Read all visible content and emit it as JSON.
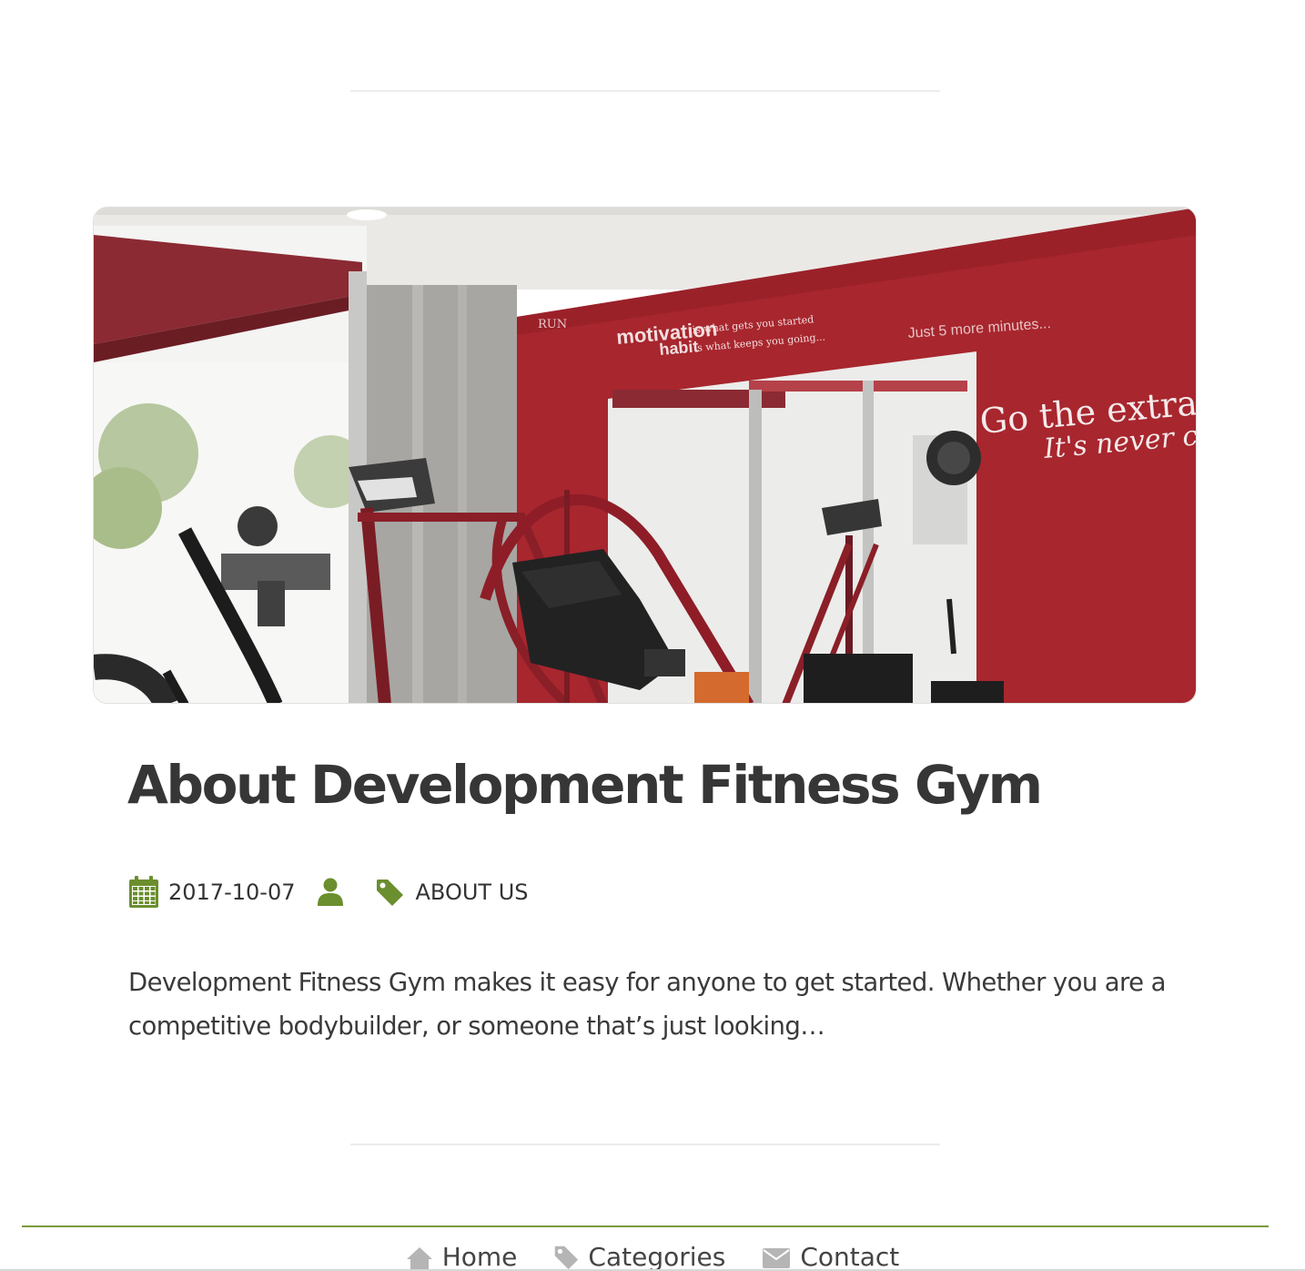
{
  "post": {
    "title": "About Development Fitness Gym",
    "date": "2017-10-07",
    "category": "ABOUT US",
    "excerpt": "Development Fitness Gym makes it easy for anyone to get started. Whether you are a competitive bodybuilder, or someone that’s just looking…",
    "image": {
      "wall_text_1a": "motivation",
      "wall_text_1b": "is what gets you started",
      "wall_text_2a": "habit",
      "wall_text_2b": "is what keeps you going...",
      "wall_text_run": "RUN",
      "wall_text_3": "Just 5 more minutes...",
      "wall_text_4": "Go the extra m",
      "wall_text_5": "It's never crow"
    }
  },
  "footer": {
    "nav": [
      {
        "label": "Home",
        "icon": "home-icon"
      },
      {
        "label": "Categories",
        "icon": "tag-icon"
      },
      {
        "label": "Contact",
        "icon": "envelope-icon"
      }
    ]
  },
  "colors": {
    "accent": "#6b8e2e",
    "title": "#363636",
    "wall_red": "#a8262e"
  }
}
